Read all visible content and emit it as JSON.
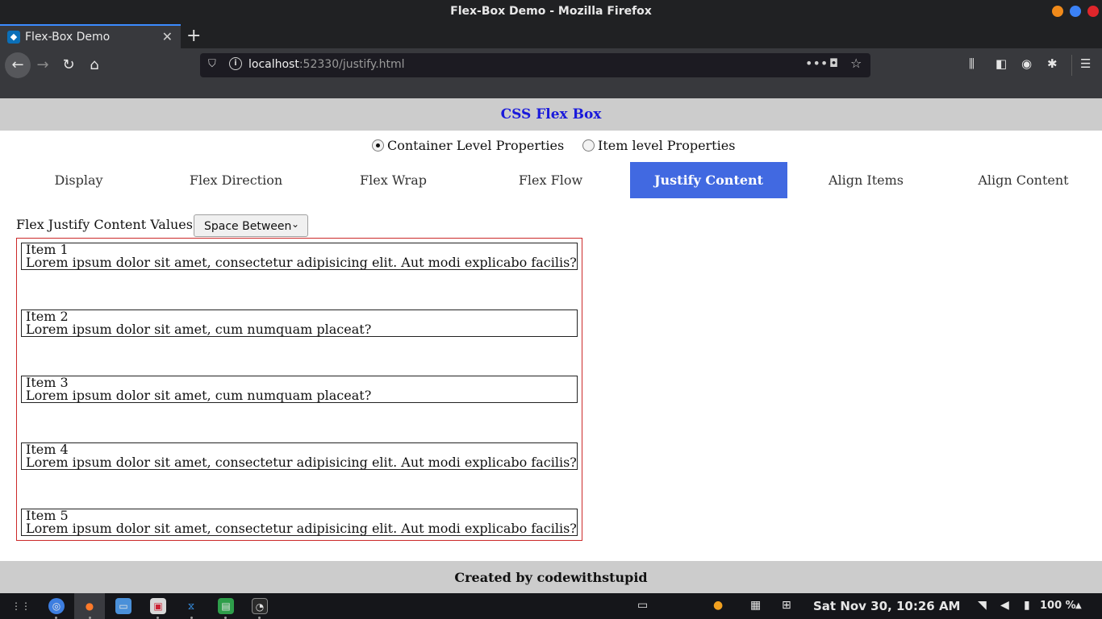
{
  "window": {
    "title": "Flex-Box Demo - Mozilla Firefox",
    "controls": {
      "minimize_color": "#f08a1a",
      "maximize_color": "#3b82f6",
      "close_color": "#e0262b"
    }
  },
  "browser": {
    "tab": {
      "title": "Flex-Box Demo",
      "close_glyph": "✕",
      "new_tab_glyph": "+"
    },
    "url": {
      "host": "localhost",
      "rest": ":52330/justify.html"
    },
    "nav_glyphs": {
      "back": "←",
      "forward": "→",
      "reload": "↻",
      "home": "⌂",
      "more": "•••",
      "star": "☆",
      "menu": "☰"
    },
    "toolbar_icons": [
      "library-icon",
      "sidebar-icon",
      "account-icon",
      "extension-icon",
      "menu-icon"
    ]
  },
  "page": {
    "header": {
      "title": "CSS Flex Box",
      "title_color": "#1a1adb",
      "background": "#cccccc"
    },
    "radios": [
      {
        "label": "Container Level Properties",
        "checked": true
      },
      {
        "label": "Item level Properties",
        "checked": false
      }
    ],
    "nav_tabs": [
      {
        "label": "Display",
        "active": false
      },
      {
        "label": "Flex Direction",
        "active": false
      },
      {
        "label": "Flex Wrap",
        "active": false
      },
      {
        "label": "Flex Flow",
        "active": false
      },
      {
        "label": "Justify Content",
        "active": true
      },
      {
        "label": "Align Items",
        "active": false
      },
      {
        "label": "Align Content",
        "active": false
      }
    ],
    "active_tab_color": "#4169e1",
    "select": {
      "label": "Flex Justify Content Values",
      "value": "Space Between",
      "chevron": "⌄"
    },
    "container_border_color": "#cc2a2a",
    "items": [
      {
        "title": "Item 1",
        "text": "Lorem ipsum dolor sit amet, consectetur adipisicing elit. Aut modi explicabo facilis?"
      },
      {
        "title": "Item 2",
        "text": "Lorem ipsum dolor sit amet, cum numquam placeat?"
      },
      {
        "title": "Item 3",
        "text": "Lorem ipsum dolor sit amet, cum numquam placeat?"
      },
      {
        "title": "Item 4",
        "text": "Lorem ipsum dolor sit amet, consectetur adipisicing elit. Aut modi explicabo facilis?"
      },
      {
        "title": "Item 5",
        "text": "Lorem ipsum dolor sit amet, consectetur adipisicing elit. Aut modi explicabo facilis?"
      }
    ],
    "footer": {
      "text": "Created by codewithstupid"
    }
  },
  "taskbar": {
    "apps": [
      "apps-grid-icon",
      "chrome-icon",
      "firefox-icon",
      "files-icon",
      "screenshot-icon",
      "vscode-icon",
      "spreadsheet-icon",
      "terminal-icon"
    ],
    "tray": [
      "display-icon",
      "update-icon",
      "cpu-icon",
      "screen-icon",
      "wifi-icon",
      "volume-icon",
      "battery-icon"
    ],
    "clock": "Sat Nov 30, 10:26 AM",
    "battery": "100 %",
    "tray_arrow": "▲"
  }
}
